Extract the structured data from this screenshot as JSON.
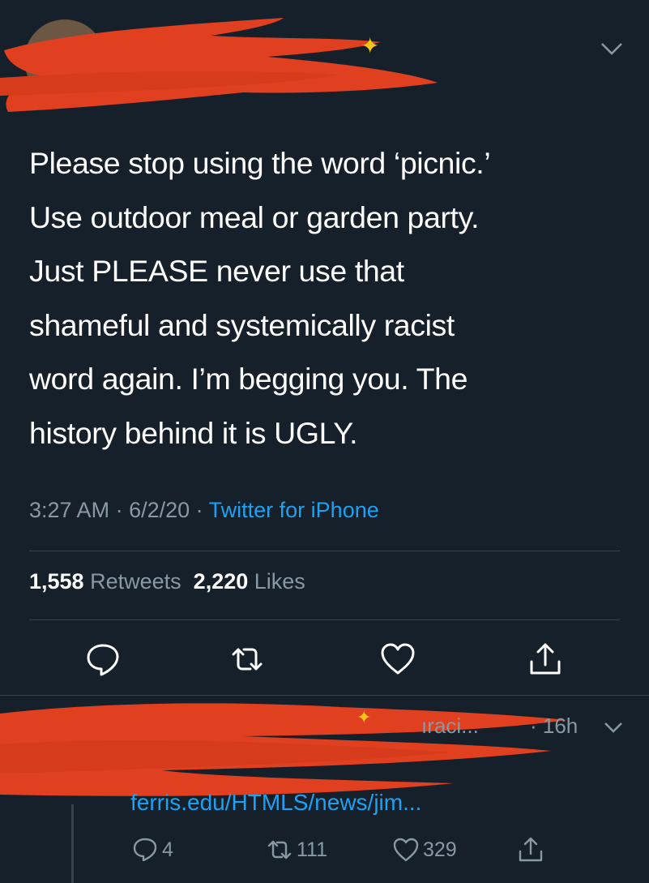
{
  "tweet": {
    "text_lines": [
      "Please stop using the word ‘picnic.’",
      "Use outdoor meal or garden party.",
      "Just PLEASE never use that",
      "shameful and systemically racist",
      "word again. I’m begging you. The",
      "history behind it is UGLY."
    ],
    "time": "3:27 AM",
    "date": "6/2/20",
    "source": "Twitter for iPhone",
    "separator": " · ",
    "retweets_count": "1,558",
    "retweets_label": "Retweets",
    "likes_count": "2,220",
    "likes_label": "Likes"
  },
  "reply": {
    "name_tail": "ıraci...",
    "time_tail": "· 16h",
    "link": "ferris.edu/HTMLS/news/jim...",
    "reply_count": "4",
    "retweet_count": "111",
    "like_count": "329"
  },
  "icons": {
    "reply": "reply-icon",
    "retweet": "retweet-icon",
    "like": "heart-icon",
    "share": "share-icon",
    "more": "chevron-down-icon"
  },
  "colors": {
    "background": "#15202b",
    "link": "#1da1f2",
    "secondary": "#8899a6",
    "redaction": "#e0401f"
  }
}
